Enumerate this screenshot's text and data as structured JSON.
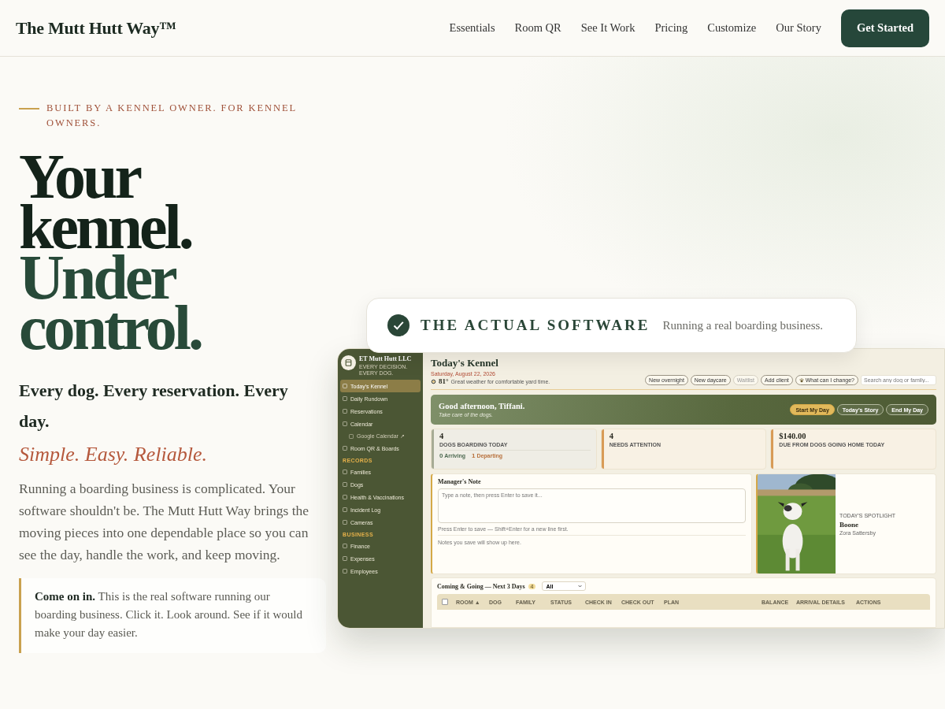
{
  "nav": {
    "logo": "The Mutt Hutt Way™",
    "links": [
      "Essentials",
      "Room QR",
      "See It Work",
      "Pricing",
      "Customize",
      "Our Story"
    ],
    "cta": "Get Started"
  },
  "hero": {
    "eyebrow": "BUILT BY A KENNEL OWNER. FOR KENNEL OWNERS.",
    "title_lines": [
      {
        "text": "Your",
        "kind": "primary"
      },
      {
        "text": "kennel.",
        "kind": "primary"
      },
      {
        "text": "Under",
        "kind": "accent"
      },
      {
        "text": "control.",
        "kind": "accent"
      }
    ],
    "tagline": "Every dog. Every reservation. Every day.",
    "slogan": "Simple. Easy. Reliable.",
    "body": "Running a boarding business is complicated. Your software shouldn't be. The Mutt Hutt Way brings the moving pieces into one dependable place so you can see the day, handle the work, and keep moving.",
    "callout": "**Come on in.** This is the real software running our boarding business. Click it. Look around. See if it would make your day easier."
  },
  "badge": {
    "title": "THE ACTUAL SOFTWARE",
    "text": "Running a real boarding business."
  },
  "app": {
    "sidebar": {
      "business": "ET Mutt Hutt LLC",
      "motto": "EVERY DECISION. EVERY DOG.",
      "sections": [
        {
          "items": [
            {
              "label": "Today's Kennel",
              "selected": true
            },
            {
              "label": "Daily Rundown",
              "selected": false
            },
            {
              "label": "Reservations",
              "selected": false
            },
            {
              "label": "Calendar",
              "selected": false,
              "children": [
                {
                  "label": "Google Calendar ↗",
                  "selected": false
                }
              ]
            },
            {
              "label": "Room QR & Boards",
              "selected": false
            }
          ]
        },
        {
          "heading": "RECORDS",
          "items": [
            {
              "label": "Families",
              "selected": false
            },
            {
              "label": "Dogs",
              "selected": false
            },
            {
              "label": "Health & Vaccinations",
              "selected": false
            },
            {
              "label": "Incident Log",
              "selected": false
            },
            {
              "label": "Cameras",
              "selected": false
            }
          ]
        },
        {
          "heading": "BUSINESS",
          "items": [
            {
              "label": "Finance",
              "selected": false
            },
            {
              "label": "Expenses",
              "selected": false
            },
            {
              "label": "Employees",
              "selected": false
            }
          ]
        }
      ]
    },
    "header": {
      "title": "Today's Kennel",
      "date": "Saturday, August 22, 2026",
      "temperature": "81°",
      "weather": "Great weather for comfortable yard time.",
      "actions": [
        {
          "label": "New overnight",
          "kind": "plain",
          "disabled": false
        },
        {
          "label": "New daycare",
          "kind": "plain",
          "disabled": false
        },
        {
          "label": "Waitlist",
          "kind": "plain",
          "disabled": true
        },
        {
          "label": "Add client",
          "kind": "plain",
          "disabled": false
        },
        {
          "label": "What can I change?",
          "kind": "help",
          "disabled": false
        }
      ],
      "search_placeholder": "Search any dog or family..."
    },
    "greeting": {
      "title": "Good afternoon, Tiffani.",
      "subtitle": "Take care of the dogs.",
      "buttons": [
        {
          "label": "Start My Day",
          "kind": "primary"
        },
        {
          "label": "Today's Story",
          "kind": "outline"
        },
        {
          "label": "End My Day",
          "kind": "outline"
        }
      ]
    },
    "stats": [
      {
        "value": "4",
        "label": "DOGS BOARDING TODAY",
        "color": "#a7ab95",
        "movements": [
          {
            "count": "0",
            "label": "Arriving",
            "kind": "arriving"
          },
          {
            "count": "1",
            "label": "Departing",
            "kind": "departing"
          }
        ]
      },
      {
        "value": "4",
        "label": "NEEDS ATTENTION",
        "color": "#d89b57"
      },
      {
        "value": "$140.00",
        "label": "DUE FROM DOGS GOING HOME TODAY",
        "color": "#d89b57"
      }
    ],
    "note": {
      "title": "Manager's Note",
      "placeholder": "Type a note, then press Enter to save it...",
      "hint": "Press Enter to save — Shift+Enter for a new line first.",
      "empty": "Notes you save will show up here."
    },
    "spotlight": {
      "label": "TODAY'S SPOTLIGHT",
      "name": "Boone",
      "owner": "Zora Sattersby"
    },
    "table": {
      "title": "Coming & Going — Next 3 Days",
      "count": "4",
      "filter": "All",
      "select_all_checked": false,
      "columns": [
        "ROOM ▲",
        "DOG",
        "FAMILY",
        "STATUS",
        "CHECK IN",
        "CHECK OUT",
        "PLAN",
        "BALANCE",
        "ARRIVAL DETAILS",
        "ACTIONS"
      ]
    }
  }
}
